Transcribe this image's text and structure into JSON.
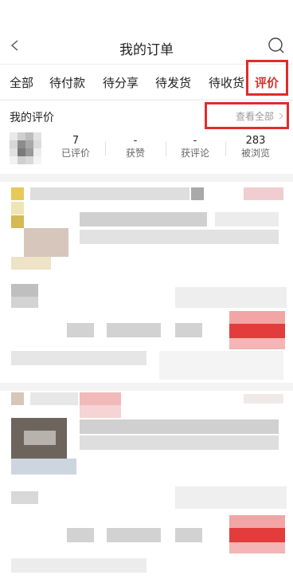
{
  "header": {
    "title": "我的订单",
    "back_icon": "back-chevron-icon",
    "search_icon": "search-icon"
  },
  "tabs": [
    {
      "label": "全部"
    },
    {
      "label": "待付款"
    },
    {
      "label": "待分享"
    },
    {
      "label": "待发货"
    },
    {
      "label": "待收货"
    },
    {
      "label": "评价",
      "active": true
    }
  ],
  "review_section": {
    "title": "我的评价",
    "view_all": "查看全部",
    "stats": [
      {
        "value": "7",
        "label": "已评价"
      },
      {
        "value": "-",
        "label": "获赞"
      },
      {
        "value": "-",
        "label": "获评论"
      },
      {
        "value": "283",
        "label": "被浏览"
      }
    ]
  },
  "colors": {
    "accent": "#e02c2c",
    "muted": "#9a9a9a",
    "divider": "#f3f3f3"
  }
}
